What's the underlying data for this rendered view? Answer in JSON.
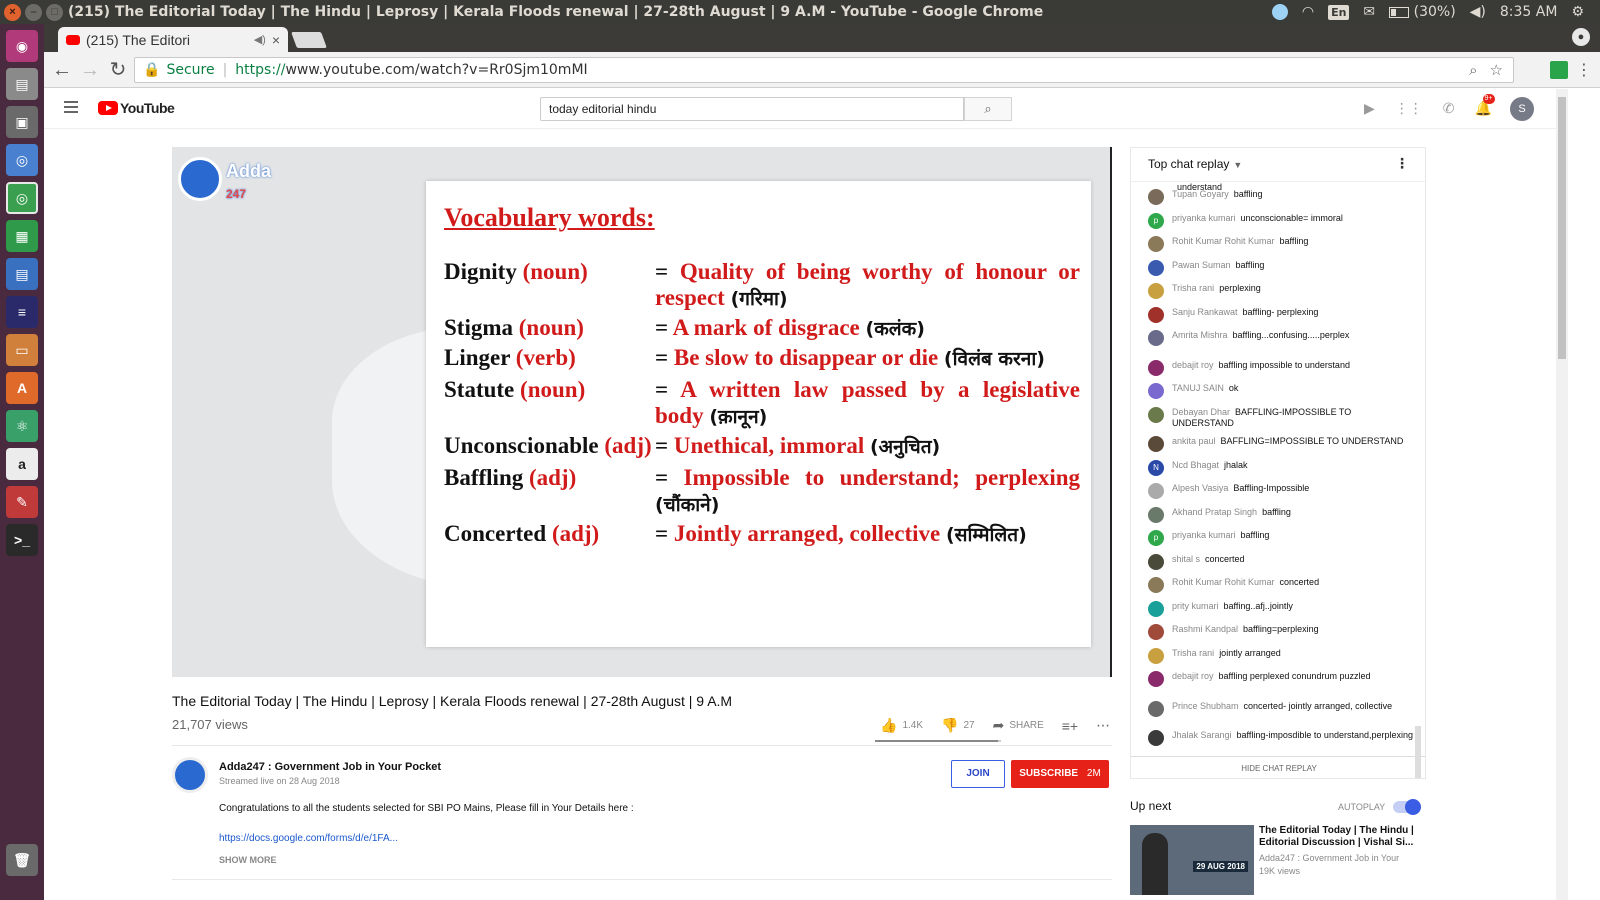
{
  "os": {
    "window_title": "(215) The Editorial Today | The Hindu | Leprosy | Kerala Floods renewal | 27-28th August | 9 A.M - YouTube - Google Chrome",
    "lang": "En",
    "battery": "(30%)",
    "clock": "8:35 AM"
  },
  "browser": {
    "tab_title": "(215) The Editori",
    "secure_label": "Secure",
    "url_scheme": "https://",
    "url_rest": "www.youtube.com/watch?v=Rr0Sjm10mMI"
  },
  "youtube": {
    "logo_text": "YouTube",
    "search_value": "today editorial hindu",
    "notif_badge": "9+",
    "avatar_letter": "S"
  },
  "video": {
    "brand_text": "Adda",
    "brand_sub": "247",
    "slide_heading": "Vocabulary words:",
    "entries": [
      {
        "word": "Dignity",
        "pos": "(noun)",
        "def": "Quality of being worthy of honour or respect",
        "hindi": "(गरिमा)"
      },
      {
        "word": "Stigma",
        "pos": "(noun)",
        "def": "A mark of disgrace",
        "hindi": "(कलंक)"
      },
      {
        "word": "Linger",
        "pos": "(verb)",
        "def": "Be slow to disappear or die",
        "hindi": "(विलंब करना)"
      },
      {
        "word": "Statute",
        "pos": "(noun)",
        "def": "A written law passed by a legislative body",
        "hindi": "(क़ानून)"
      },
      {
        "word": "Unconscionable",
        "pos": "(adj)",
        "def": "Unethical, immoral",
        "hindi": "(अनुचित)"
      },
      {
        "word": "Baffling",
        "pos": "(adj)",
        "def": "Impossible to understand; perplexing",
        "hindi": "(चौंकाने)"
      },
      {
        "word": "Concerted",
        "pos": "(adj)",
        "def": "Jointly arranged, collective",
        "hindi": "(सम्मिलित)"
      }
    ],
    "eq_sign": "=",
    "title": "The Editorial Today | The Hindu | Leprosy | Kerala Floods renewal | 27-28th August | 9 A.M",
    "views": "21,707 views",
    "likes": "1.4K",
    "dislikes": "27",
    "share_label": "SHARE",
    "like_ratio": 0.98
  },
  "channel": {
    "name": "Adda247 : Government Job in Your Pocket",
    "date": "Streamed live on 28 Aug 2018",
    "join_label": "JOIN",
    "subscribe_label": "SUBSCRIBE",
    "subscriber_count": "2M",
    "description": "Congratulations to all the students selected for SBI PO Mains, Please fill in Your Details here :",
    "link": "https://docs.google.com/forms/d/e/1FA...",
    "show_more": "SHOW MORE"
  },
  "chat": {
    "header": "Top chat replay",
    "top_cut": "understand",
    "footer": "HIDE CHAT REPLAY",
    "messages": [
      {
        "author": "Tupan Goyary",
        "text": "baffling",
        "color": "#7a6a5a",
        "letter": ""
      },
      {
        "author": "priyanka kumari",
        "text": "unconscionable= immoral",
        "color": "#2ea84a",
        "letter": "p"
      },
      {
        "author": "Rohit Kumar Rohit Kumar",
        "text": "baffling",
        "color": "#8a7a5a",
        "letter": ""
      },
      {
        "author": "Pawan Suman",
        "text": "baffling",
        "color": "#3a5ab0",
        "letter": ""
      },
      {
        "author": "Trisha rani",
        "text": "perplexing",
        "color": "#c8a040",
        "letter": ""
      },
      {
        "author": "Sanju Rankawat",
        "text": "baffling- perplexing",
        "color": "#a0302a",
        "letter": ""
      },
      {
        "author": "Amrita Mishra",
        "text": "baffling...confusing.....perplex",
        "color": "#6a6a8a",
        "letter": ""
      },
      {
        "author": "debajit roy",
        "text": "baffling impossible to understand",
        "color": "#8a2a6a",
        "letter": ""
      },
      {
        "author": "TANUJ SAIN",
        "text": "ok",
        "color": "#7a6ad0",
        "letter": ""
      },
      {
        "author": "Debayan Dhar",
        "text": "BAFFLING-IMPOSSIBLE TO UNDERSTAND",
        "color": "#6a7a4a",
        "letter": ""
      },
      {
        "author": "ankita paul",
        "text": "BAFFLING=IMPOSSIBLE TO UNDERSTAND",
        "color": "#5a4a3a",
        "letter": ""
      },
      {
        "author": "Ncd Bhagat",
        "text": "jhalak",
        "color": "#2a4aa8",
        "letter": "N"
      },
      {
        "author": "Alpesh Vasiya",
        "text": "Baffling-Impossible",
        "color": "#aaaaaa",
        "letter": ""
      },
      {
        "author": "Akhand Pratap Singh",
        "text": "baffling",
        "color": "#6a7a6a",
        "letter": ""
      },
      {
        "author": "priyanka kumari",
        "text": "baffling",
        "color": "#2ea84a",
        "letter": "p"
      },
      {
        "author": "shital s",
        "text": "concerted",
        "color": "#4a4a3a",
        "letter": ""
      },
      {
        "author": "Rohit Kumar Rohit Kumar",
        "text": "concerted",
        "color": "#8a7a5a",
        "letter": ""
      },
      {
        "author": "prity kumari",
        "text": "baffing..afj..jointly",
        "color": "#1aa098",
        "letter": ""
      },
      {
        "author": "Rashmi Kandpal",
        "text": "baffling=perplexing",
        "color": "#a04a3a",
        "letter": ""
      },
      {
        "author": "Trisha rani",
        "text": "jointly arranged",
        "color": "#c8a040",
        "letter": ""
      },
      {
        "author": "debajit roy",
        "text": "baffling perplexed conundrum puzzled",
        "color": "#8a2a6a",
        "letter": ""
      },
      {
        "author": "Prince Shubham",
        "text": "concerted- jointly arranged, collective",
        "color": "#6a6a6a",
        "letter": ""
      },
      {
        "author": "Jhalak Sarangi",
        "text": "baffling-imposdible to understand,perplexing",
        "color": "#3a3a3a",
        "letter": ""
      }
    ]
  },
  "upnext": {
    "label": "Up next",
    "autoplay": "AUTOPLAY",
    "title": "The Editorial Today | The Hindu | Editorial Discussion | Vishal Si...",
    "channel": "Adda247 : Government Job in Your",
    "views": "19K views",
    "thumb_date": "29 AUG 2018"
  }
}
